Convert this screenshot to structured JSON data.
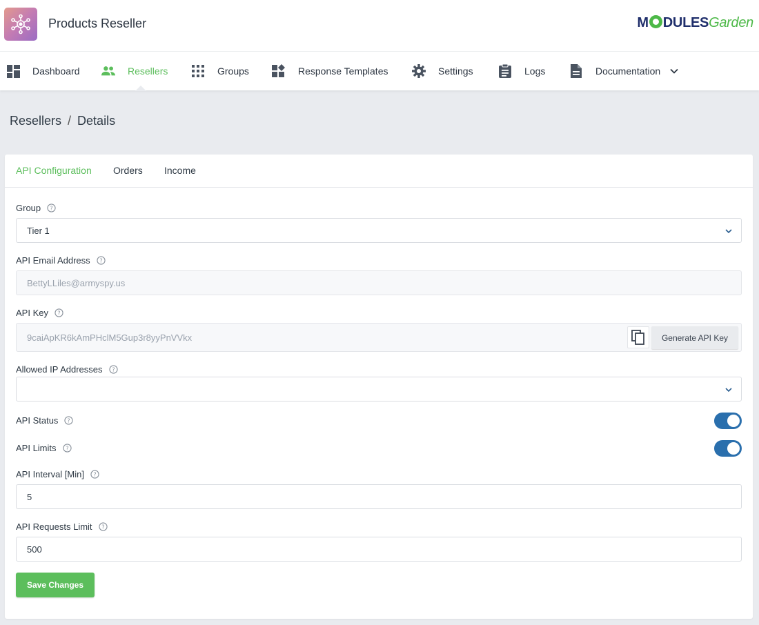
{
  "header": {
    "app_title": "Products Reseller",
    "brand": {
      "part1": "M",
      "part2": "DULES",
      "part3": "Garden"
    }
  },
  "nav": {
    "items": [
      {
        "label": "Dashboard",
        "icon": "dashboard-icon"
      },
      {
        "label": "Resellers",
        "icon": "users-icon",
        "active": true
      },
      {
        "label": "Groups",
        "icon": "grid-icon"
      },
      {
        "label": "Response Templates",
        "icon": "templates-icon"
      },
      {
        "label": "Settings",
        "icon": "gear-icon"
      },
      {
        "label": "Logs",
        "icon": "clipboard-icon"
      },
      {
        "label": "Documentation",
        "icon": "document-icon"
      }
    ]
  },
  "breadcrumb": {
    "parent": "Resellers",
    "separator": "/",
    "current": "Details"
  },
  "tabs": [
    {
      "label": "API Configuration",
      "active": true
    },
    {
      "label": "Orders"
    },
    {
      "label": "Income"
    }
  ],
  "form": {
    "group": {
      "label": "Group",
      "value": "Tier 1"
    },
    "email": {
      "label": "API Email Address",
      "value": "BettyLLiles@armyspy.us"
    },
    "api_key": {
      "label": "API Key",
      "value": "9caiApKR6kAmPHclM5Gup3r8yyPnVVkx",
      "generate_label": "Generate API Key"
    },
    "allowed_ips": {
      "label": "Allowed IP Addresses",
      "value": ""
    },
    "api_status": {
      "label": "API Status",
      "enabled": true
    },
    "api_limits": {
      "label": "API Limits",
      "enabled": true
    },
    "api_interval": {
      "label": "API Interval [Min]",
      "value": "5"
    },
    "api_requests_limit": {
      "label": "API Requests Limit",
      "value": "500"
    },
    "save_label": "Save Changes"
  },
  "colors": {
    "accent": "#5cbe5c",
    "toggle": "#2a6fad",
    "brand_dark": "#1f2e6b"
  }
}
